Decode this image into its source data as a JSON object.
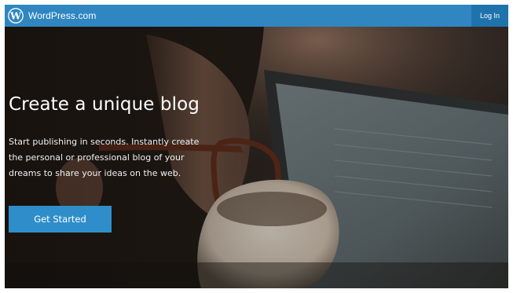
{
  "header": {
    "brand_name": "WordPress.com",
    "login_label": "Log In",
    "brand_color": "#2f86c1"
  },
  "hero": {
    "headline": "Create a unique blog",
    "subtext": "Start publishing in seconds. Instantly create the personal or professional blog of your dreams to share your ideas on the web.",
    "cta_label": "Get Started",
    "cta_color": "#2f8ec9"
  },
  "icons": {
    "logo": "wordpress-logo-icon"
  }
}
